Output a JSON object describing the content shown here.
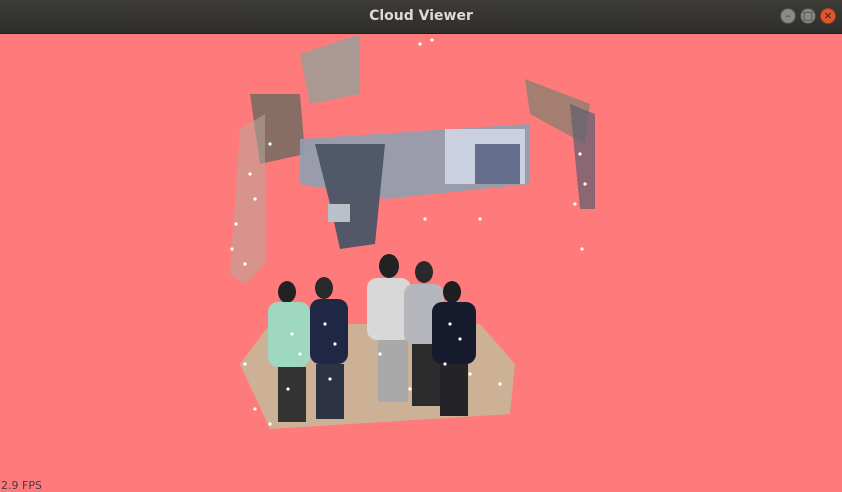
{
  "window": {
    "title": "Cloud Viewer",
    "controls": {
      "minimize_glyph": "–",
      "maximize_glyph": "□",
      "close_glyph": "×"
    }
  },
  "viewer": {
    "background_color": "#ff7b7b",
    "fps_label": "2.9 FPS",
    "content": "point-cloud"
  }
}
